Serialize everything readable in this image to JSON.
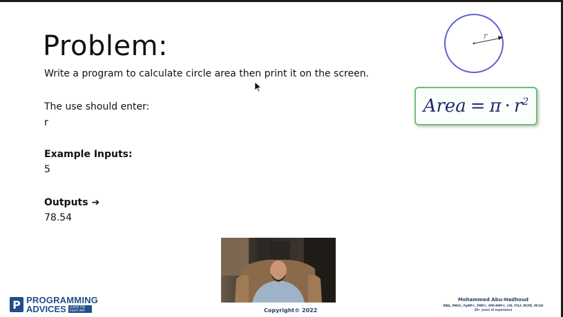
{
  "slide": {
    "title": "Problem:",
    "description": "Write a program to calculate circle area then print it on the screen.",
    "enter_label": "The use should enter:",
    "enter_value": "r",
    "example_inputs_label": "Example Inputs:",
    "example_inputs_value": "5",
    "outputs_label": "Outputs ➔",
    "outputs_value": "78.54"
  },
  "diagram": {
    "radius_label": "r",
    "circle_color": "#5b5fd6",
    "radius_label_color": "#2e9a2e"
  },
  "formula": {
    "lhs": "Area",
    "eq": "=",
    "pi": "π",
    "dot": "·",
    "var": "r",
    "exp": "2"
  },
  "footer": {
    "copyright": "Copyright© 2022",
    "logo_line1": "PROGRAMMING",
    "logo_line2": "ADVICES",
    "logo_tagline": "LEARN THE RIGHT WAY",
    "author_name": "Mohammed Abu-Hadhoud",
    "author_credentials": "MBA, PMOC, PgMP®, PMP®, PMI-RMP®, CM, ITILF, MCPD, MCSD",
    "author_experience": "20+ years of experience"
  },
  "colors": {
    "accent_green": "#6fbf6f",
    "brand_blue": "#1f4e89"
  }
}
